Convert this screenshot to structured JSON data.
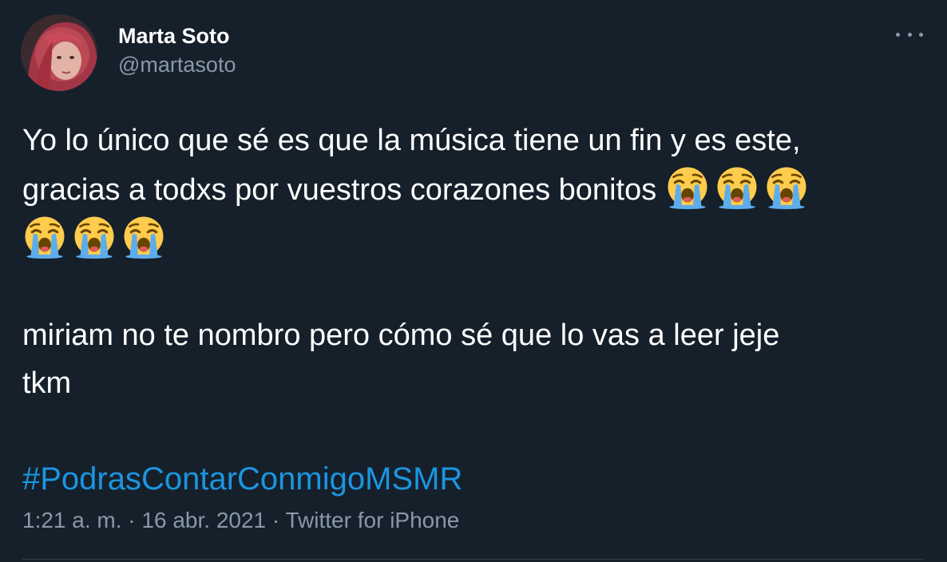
{
  "author": {
    "display_name": "Marta Soto",
    "handle": "@martasoto"
  },
  "tweet": {
    "line1_text": "Yo lo único que sé es que la música tiene un fin y es este,",
    "line2_text": "gracias a todxs por vuestros corazones bonitos",
    "emoji_name": "loudly-crying-face",
    "emoji_count": 6,
    "para2_line1": "miriam no te nombro pero cómo sé que lo vas a leer jeje",
    "para2_line2": "tkm",
    "hashtag": "#PodrasContarConmigoMSMR"
  },
  "meta": {
    "time": "1:21 a. m.",
    "separator": " · ",
    "date": "16 abr. 2021",
    "source": "Twitter for iPhone"
  },
  "colors": {
    "background": "#15202b",
    "text": "#ffffff",
    "secondary": "#8899a6",
    "link": "#1b95e0"
  }
}
